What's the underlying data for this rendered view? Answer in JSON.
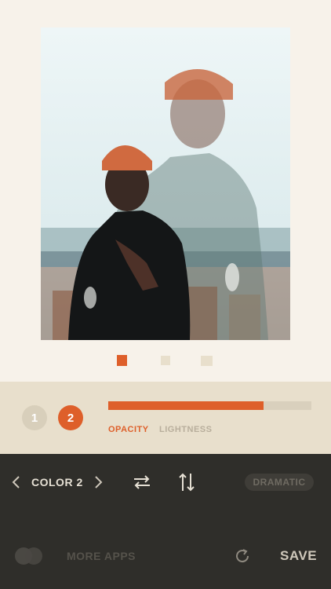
{
  "pager": {
    "page_count": 3,
    "active_page": 1
  },
  "layers": {
    "items": [
      {
        "label": "1",
        "active": false
      },
      {
        "label": "2",
        "active": true
      }
    ]
  },
  "slider": {
    "value_fraction": 0.765
  },
  "modes": {
    "opacity": "OPACITY",
    "lightness": "LIGHTNESS",
    "active": "OPACITY"
  },
  "toolbar": {
    "color_label": "COLOR 2",
    "blend_mode": "DRAMATIC",
    "more_apps": "MORE APPS",
    "save": "SAVE"
  },
  "colors": {
    "accent": "#de5f2a",
    "panel": "#e8dfcc",
    "background": "#f7f2ea",
    "toolbar": "#2f2e2a"
  },
  "icons": [
    "chevron-left-icon",
    "chevron-right-icon",
    "swap-icon",
    "flip-vertical-icon",
    "overlap-circles-icon",
    "reset-icon"
  ]
}
